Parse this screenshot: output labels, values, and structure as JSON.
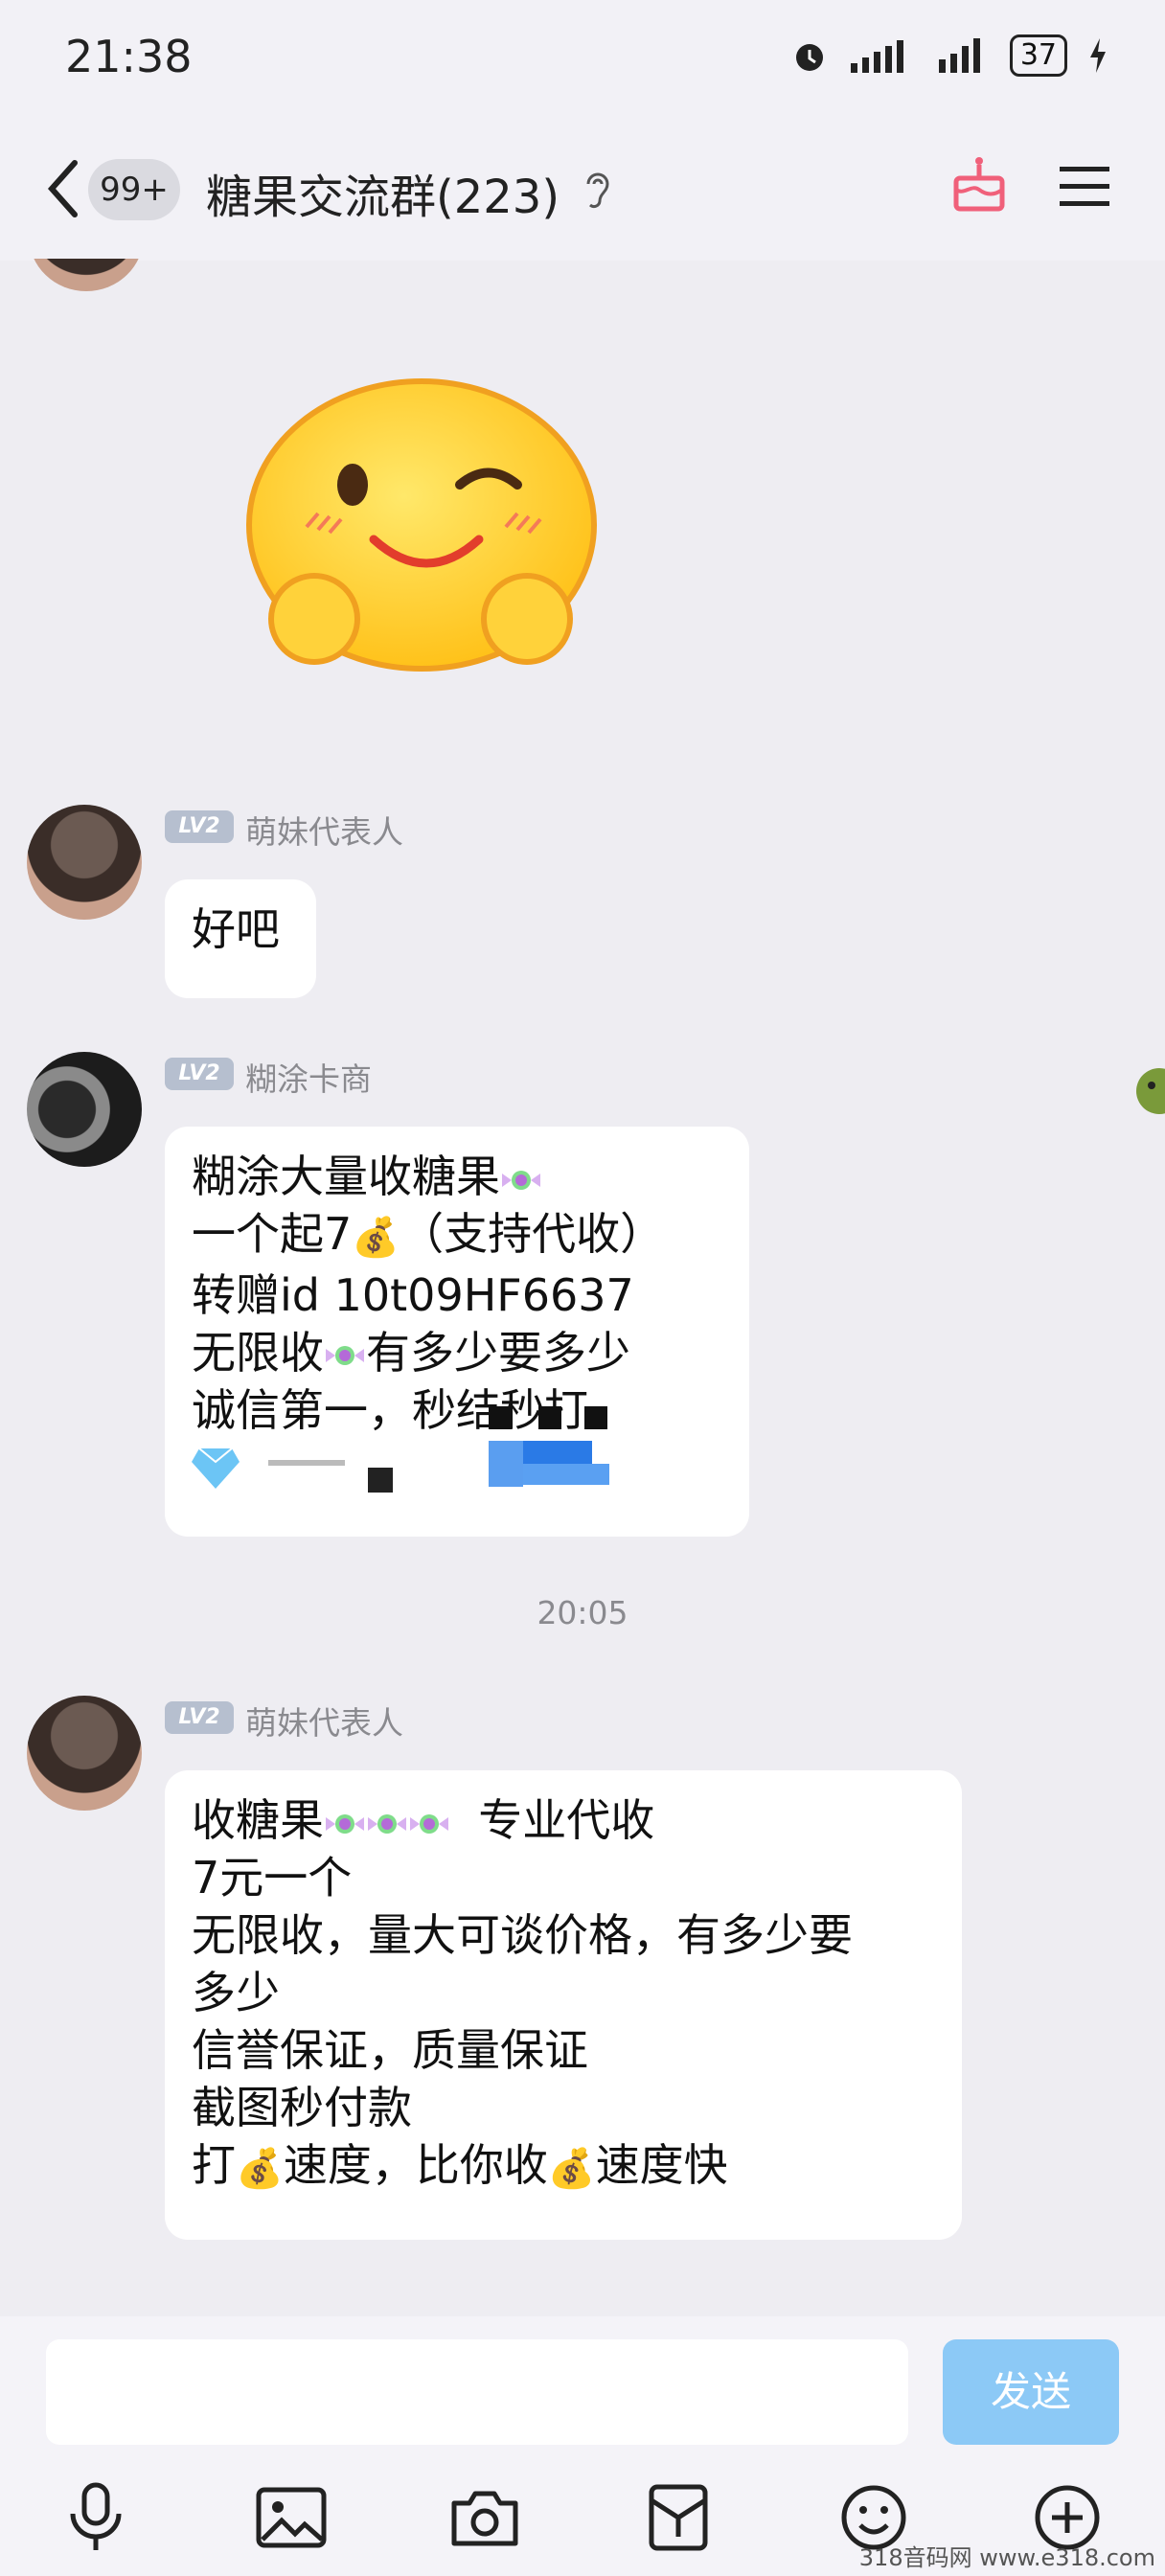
{
  "status": {
    "time": "21:38",
    "battery": "37"
  },
  "header": {
    "badge": "99+",
    "title": "糖果交流群(223)"
  },
  "messages": [
    {
      "level": "LV2",
      "sender": "萌妹代表人",
      "text": "好吧"
    },
    {
      "level": "LV2",
      "sender": "糊涂卡商",
      "lines": [
        "糊涂大量收糖果",
        "一个起7",
        "（支持代收）",
        "转赠id   10t09HF6637",
        "无限收",
        "有多少要多少",
        "诚信第一，秒结秒打"
      ]
    },
    {
      "level": "LV2",
      "sender": "萌妹代表人",
      "lines": [
        "收糖果",
        "  专业代收",
        "7元一个",
        "无限收，量大可谈价格，有多少要",
        "多少",
        "信誉保证，质量保证",
        "截图秒付款",
        "打",
        "速度，比你收",
        "速度快"
      ]
    }
  ],
  "timestamp": "20:05",
  "input": {
    "send_label": "发送"
  },
  "toolbar": [
    "mic-icon",
    "image-icon",
    "camera-icon",
    "red-packet-icon",
    "emoji-icon",
    "plus-icon"
  ],
  "watermark": "318音码网  www.e318.com",
  "colors": {
    "background": "#eeedf2",
    "send": "#8cc9f6",
    "level_badge": "#b6bfcf",
    "cake": "#f0607a"
  }
}
